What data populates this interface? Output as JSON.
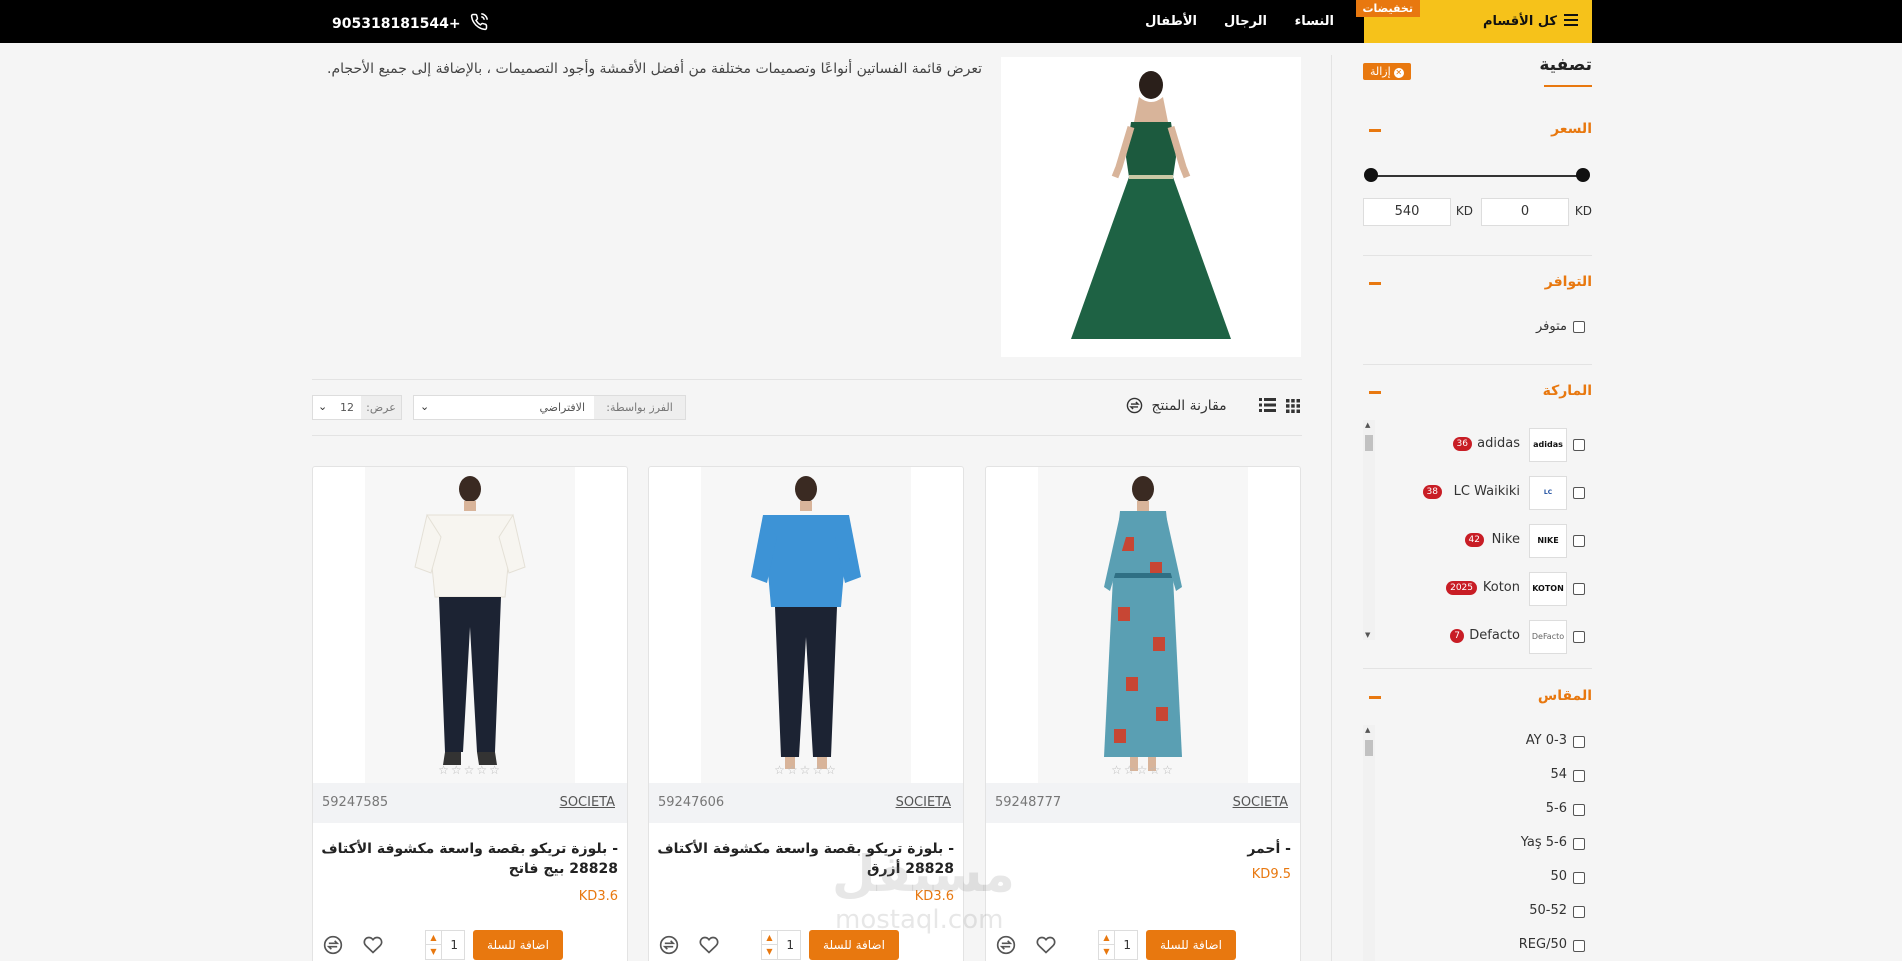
{
  "topbar": {
    "all_categories": "كل الأقسام",
    "sale_tag": "تخفيضات",
    "nav": [
      "النساء",
      "الرجال",
      "الأطفال"
    ],
    "phone": "905318181544+"
  },
  "sidebar": {
    "title": "تصفية",
    "reset": "إزالة",
    "price": {
      "heading": "السعر",
      "min": "0",
      "max": "540",
      "currency": "KD"
    },
    "availability": {
      "heading": "التوافر",
      "option": "متوفر"
    },
    "brand": {
      "heading": "الماركة",
      "items": [
        {
          "name": "adidas",
          "count": "36",
          "logo": "adidas"
        },
        {
          "name": "LC Waikiki",
          "count": "38",
          "logo": "LC WAIKIKI"
        },
        {
          "name": "Nike",
          "count": "42",
          "logo": "NIKE"
        },
        {
          "name": "Koton",
          "count": "2025",
          "logo": "KOTON"
        },
        {
          "name": "Defacto",
          "count": "7",
          "logo": "DeFacto"
        }
      ]
    },
    "size": {
      "heading": "المقاس",
      "items": [
        "AY 0-3",
        "54",
        "5-6",
        "Yaş 5-6",
        "50",
        "50-52",
        "REG/50"
      ]
    }
  },
  "main": {
    "description": "تعرض قائمة الفساتين أنواعًا وتصميمات مختلفة من أفضل الأقمشة وأجود التصميمات ، بالإضافة إلى جميع الأحجام.",
    "compare_label": "مقارنة المنتج",
    "sort_label": "الفرز بواسطة:",
    "sort_value": "الافتراضي",
    "show_label": "عرض:",
    "show_value": "12",
    "add_to_cart": "اضافة للسلة",
    "products": [
      {
        "brand": "SOCIETA",
        "sku": "59248777",
        "name": "- أحمر",
        "price": "KD9.5",
        "qty": "1"
      },
      {
        "brand": "SOCIETA",
        "sku": "59247606",
        "name": "- بلوزة تريكو بقصة واسعة مكشوفة الأكتاف 28828 أزرق",
        "price": "KD3.6",
        "qty": "1"
      },
      {
        "brand": "SOCIETA",
        "sku": "59247585",
        "name": "- بلوزة تريكو بقصة واسعة مكشوفة الأكتاف 28828 بيج فاتح",
        "price": "KD3.6",
        "qty": "1"
      }
    ]
  },
  "watermark": {
    "line1": "مستقل",
    "line2": "mostaql.com"
  },
  "colors": {
    "accent": "#e8780f",
    "topbar": "#000000",
    "highlight": "#f6c21a",
    "badge": "#c81d25"
  }
}
